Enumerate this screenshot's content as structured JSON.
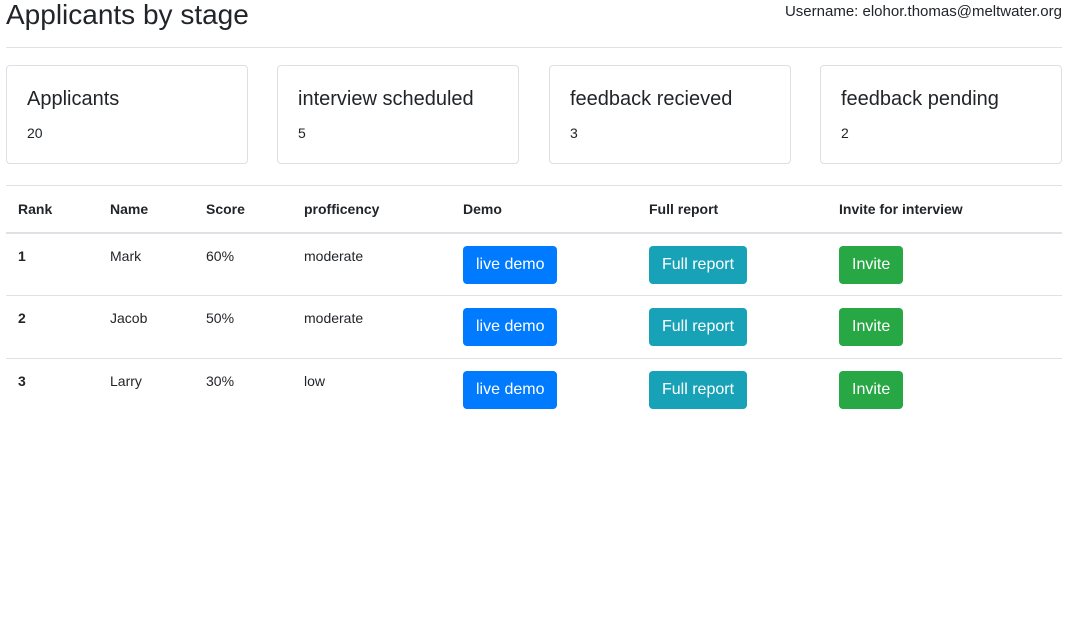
{
  "header": {
    "title": "Applicants by stage",
    "username": "Username: elohor.thomas@meltwater.org"
  },
  "cards": [
    {
      "title": "Applicants",
      "value": "20"
    },
    {
      "title": "interview scheduled",
      "value": "5"
    },
    {
      "title": "feedback recieved",
      "value": "3"
    },
    {
      "title": "feedback pending",
      "value": "2"
    }
  ],
  "table": {
    "headers": [
      "Rank",
      "Name",
      "Score",
      "profficency",
      "Demo",
      "Full report",
      "Invite for interview"
    ],
    "rows": [
      {
        "rank": "1",
        "name": "Mark",
        "score": "60%",
        "proficiency": "moderate",
        "demo": "live demo",
        "report": "Full report",
        "invite": "Invite"
      },
      {
        "rank": "2",
        "name": "Jacob",
        "score": "50%",
        "proficiency": "moderate",
        "demo": "live demo",
        "report": "Full report",
        "invite": "Invite"
      },
      {
        "rank": "3",
        "name": "Larry",
        "score": "30%",
        "proficiency": "low",
        "demo": "live demo",
        "report": "Full report",
        "invite": "Invite"
      }
    ]
  },
  "colors": {
    "demo_button": "#007bff",
    "report_button": "#17a2b8",
    "invite_button": "#28a745"
  }
}
